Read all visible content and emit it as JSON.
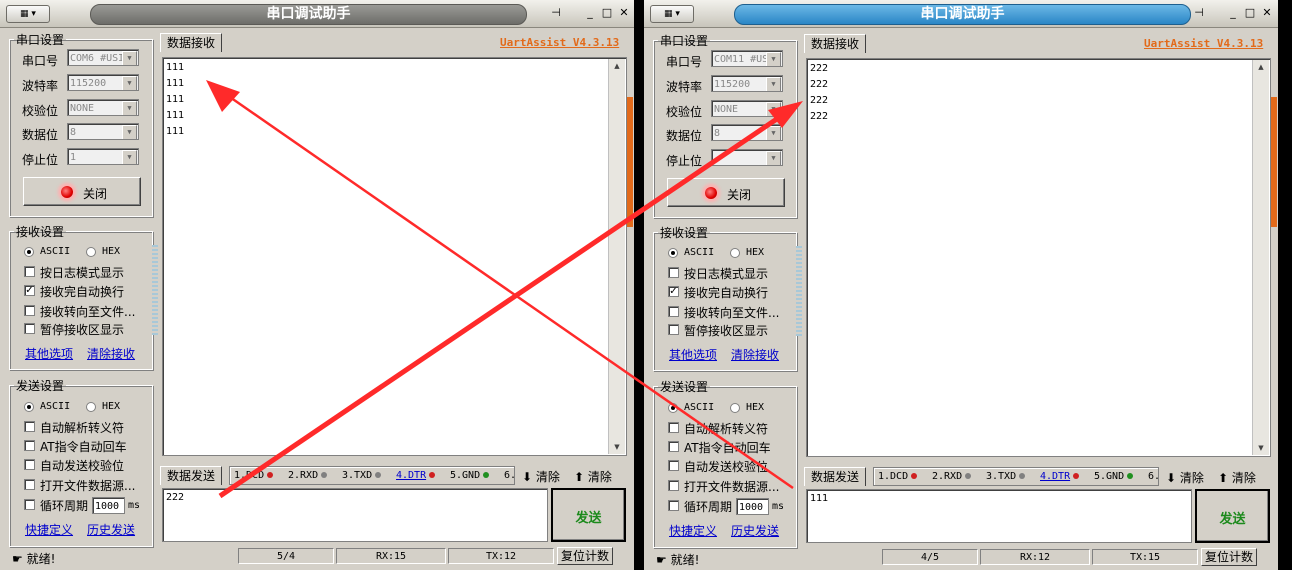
{
  "app_title": "串口调试助手",
  "version": "UartAssist V4.3.13",
  "tab_receive": "数据接收",
  "tab_send": "数据发送",
  "serial_group": {
    "legend": "串口设置",
    "port_label": "串口号",
    "baud_label": "波特率",
    "parity_label": "校验位",
    "databits_label": "数据位",
    "stopbits_label": "停止位",
    "close_button": "关闭"
  },
  "recv_group": {
    "legend": "接收设置",
    "ascii": "ASCII",
    "hex": "HEX",
    "options": [
      {
        "label": "按日志模式显示",
        "checked": false
      },
      {
        "label": "接收完自动换行",
        "checked": true
      },
      {
        "label": "接收转向至文件...",
        "checked": false
      },
      {
        "label": "暂停接收区显示",
        "checked": false
      }
    ],
    "link_more": "其他选项",
    "link_clear": "清除接收"
  },
  "send_group": {
    "legend": "发送设置",
    "ascii": "ASCII",
    "hex": "HEX",
    "options": [
      {
        "label": "自动解析转义符",
        "checked": false
      },
      {
        "label": "AT指令自动回车",
        "checked": false
      },
      {
        "label": "自动发送校验位",
        "checked": false
      },
      {
        "label": "打开文件数据源...",
        "checked": false
      }
    ],
    "loop_label": "循环周期",
    "loop_value": "1000",
    "loop_unit": "ms",
    "link_shortcut": "快捷定义",
    "link_history": "历史发送"
  },
  "pins": [
    "1.DCD",
    "2.RXD",
    "3.TXD",
    "4.DTR",
    "5.GND",
    "6."
  ],
  "pin_colors": [
    "#d02020",
    "#808080",
    "#808080",
    "#d02020",
    "#209020"
  ],
  "clear_label": "清除",
  "send_button": "发送",
  "status_ready": "就绪!",
  "reset_button": "复位计数",
  "windows": [
    {
      "port": "COM6 #USI",
      "baud": "115200",
      "parity": "NONE",
      "databits": "8",
      "stopbits": "1",
      "received": [
        "111",
        "111",
        "111",
        "111",
        "111"
      ],
      "send_text": "222",
      "status_count": "5/4",
      "rx": "RX:15",
      "tx": "TX:12"
    },
    {
      "port": "COM11 #US",
      "baud": "115200",
      "parity": "NONE",
      "databits": "8",
      "stopbits": "",
      "received": [
        "222",
        "222",
        "222",
        "222"
      ],
      "send_text": "111",
      "status_count": "4/5",
      "rx": "RX:12",
      "tx": "TX:15"
    }
  ],
  "colors": {
    "accent_orange": "#e26a1a",
    "title_active": "#2a86c6",
    "arrow_red": "#ff2a2a",
    "send_green": "#1c8a1c"
  }
}
